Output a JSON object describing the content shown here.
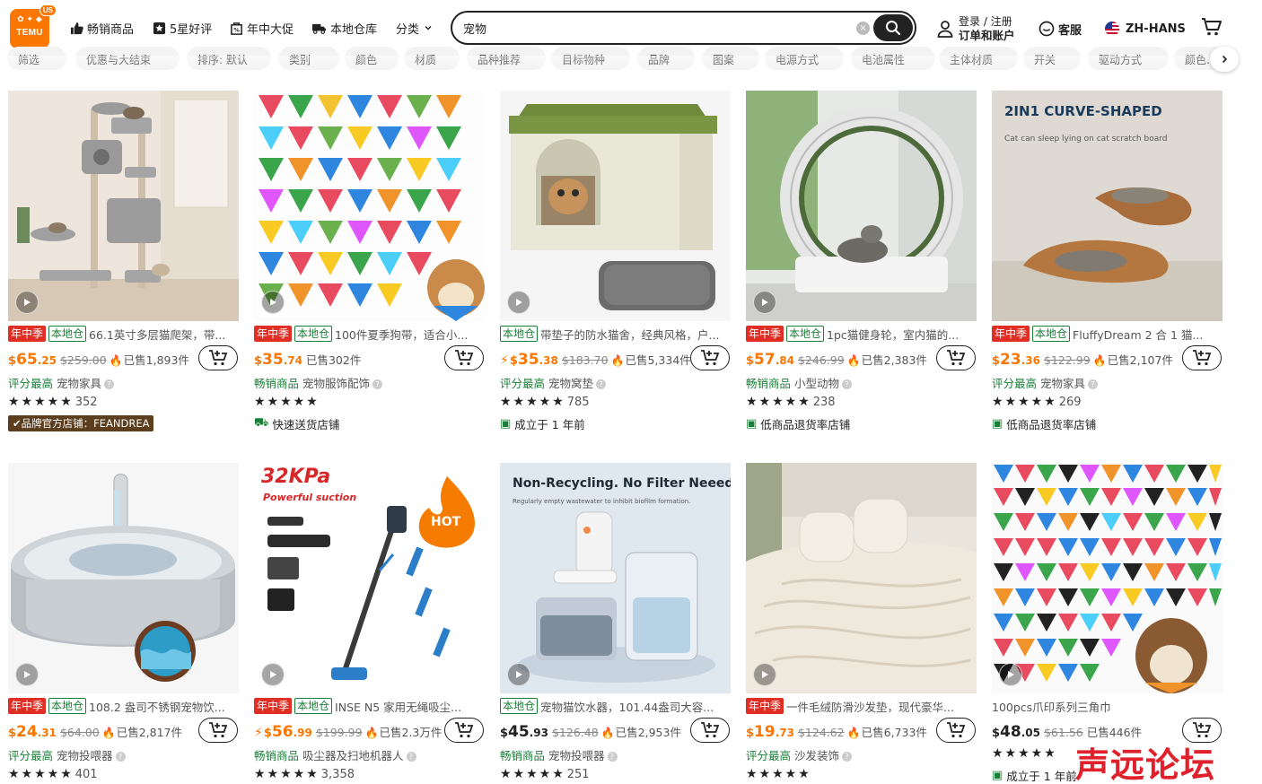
{
  "header": {
    "logo_text": "TEMU",
    "logo_badge": "US",
    "nav": [
      "畅销商品",
      "5星好评",
      "年中大促",
      "本地仓库",
      "分类"
    ],
    "search_value": "宠物",
    "account_line1": "登录 / 注册",
    "account_line2": "订单和账户",
    "support": "客服",
    "language": "ZH-HANS"
  },
  "filters": [
    "筛选",
    "优惠与大结束",
    "排序: 默认",
    "类别",
    "颜色",
    "材质",
    "品种推荐",
    "目标物种",
    "品牌",
    "图案",
    "电源方式",
    "电池属性",
    "主体材质",
    "开关",
    "驱动方式",
    "颜色..."
  ],
  "products": [
    {
      "tags": [
        "年中季",
        "本地仓"
      ],
      "title": "66.1英寸多层猫爬架，带...",
      "flash": false,
      "price_int": "65",
      "price_dec": ".25",
      "orig_price": "$259.00",
      "sold": "已售1,893件",
      "highlight": "评分最高",
      "category": "宠物家具",
      "reviews": "352",
      "badge_type": "brand",
      "badge_text": "品牌官方店铺：FEANDREA"
    },
    {
      "tags": [
        "年中季",
        "本地仓"
      ],
      "title": "100件夏季狗带，适合小...",
      "flash": false,
      "price_int": "35",
      "price_dec": ".74",
      "orig_price": "",
      "sold": "已售302件",
      "highlight": "畅销商品",
      "category": "宠物服饰配饰",
      "reviews": "",
      "badge_type": "icon",
      "badge_text": "快速送货店铺"
    },
    {
      "tags": [
        "本地仓"
      ],
      "title": "带垫子的防水猫舍，经典风格，户...",
      "flash": true,
      "price_int": "35",
      "price_dec": ".38",
      "orig_price": "$183.70",
      "sold": "已售5,334件",
      "highlight": "评分最高",
      "category": "宠物窝垫",
      "reviews": "785",
      "badge_type": "icon",
      "badge_text": "成立于 1 年前"
    },
    {
      "tags": [
        "年中季",
        "本地仓"
      ],
      "title": "1pc猫健身轮，室内猫的...",
      "flash": false,
      "price_int": "57",
      "price_dec": ".84",
      "orig_price": "$246.99",
      "sold": "已售2,383件",
      "highlight": "畅销商品",
      "category": "小型动物",
      "reviews": "238",
      "badge_type": "icon",
      "badge_text": "低商品退货率店铺"
    },
    {
      "tags": [
        "年中季",
        "本地仓"
      ],
      "title": "FluffyDream 2 合 1 猫...",
      "flash": false,
      "price_int": "23",
      "price_dec": ".36",
      "orig_price": "$122.99",
      "sold": "已售2,107件",
      "highlight": "评分最高",
      "category": "宠物家具",
      "reviews": "269",
      "badge_type": "icon",
      "badge_text": "低商品退货率店铺"
    },
    {
      "tags": [
        "年中季",
        "本地仓"
      ],
      "title": "108.2 盎司不锈钢宠物饮...",
      "flash": false,
      "price_int": "24",
      "price_dec": ".31",
      "orig_price": "$64.00",
      "sold": "已售2,817件",
      "highlight": "评分最高",
      "category": "宠物投喂器",
      "reviews": "401",
      "badge_type": "none",
      "badge_text": ""
    },
    {
      "tags": [
        "年中季",
        "本地仓"
      ],
      "title": "INSE N5 家用无绳吸尘...",
      "flash": true,
      "price_int": "56",
      "price_dec": ".99",
      "orig_price": "$199.99",
      "sold": "已售2.3万件",
      "highlight": "畅销商品",
      "category": "吸尘器及扫地机器人",
      "reviews": "3,358",
      "badge_type": "none",
      "badge_text": ""
    },
    {
      "tags": [
        "本地仓"
      ],
      "title": "宠物猫饮水器，101.44盎司大容...",
      "flash": false,
      "price_int": "45",
      "price_dec": ".93",
      "orig_price": "$126.48",
      "sold": "已售2,953件",
      "highlight": "畅销商品",
      "category": "宠物投喂器",
      "reviews": "251",
      "badge_type": "none",
      "badge_text": ""
    },
    {
      "tags": [
        "年中季"
      ],
      "title": "一件毛绒防滑沙发垫，现代豪华...",
      "flash": false,
      "price_int": "19",
      "price_dec": ".73",
      "orig_price": "$124.62",
      "sold": "已售6,733件",
      "highlight": "评分最高",
      "category": "沙发装饰",
      "reviews": "",
      "badge_type": "none",
      "badge_text": ""
    },
    {
      "tags": [],
      "title": "100pcs爪印系列三角巾",
      "flash": false,
      "price_int": "48",
      "price_dec": ".05",
      "orig_price": "$61.56",
      "sold": "已售446件",
      "highlight": "",
      "category": "",
      "reviews": "",
      "badge_type": "icon",
      "badge_text": "成立于 1 年前"
    }
  ],
  "overlay_text": "声远论坛",
  "colors": {
    "accent": "#fb7701",
    "promo_red": "#e02e24",
    "local_green": "#1a7f37"
  }
}
